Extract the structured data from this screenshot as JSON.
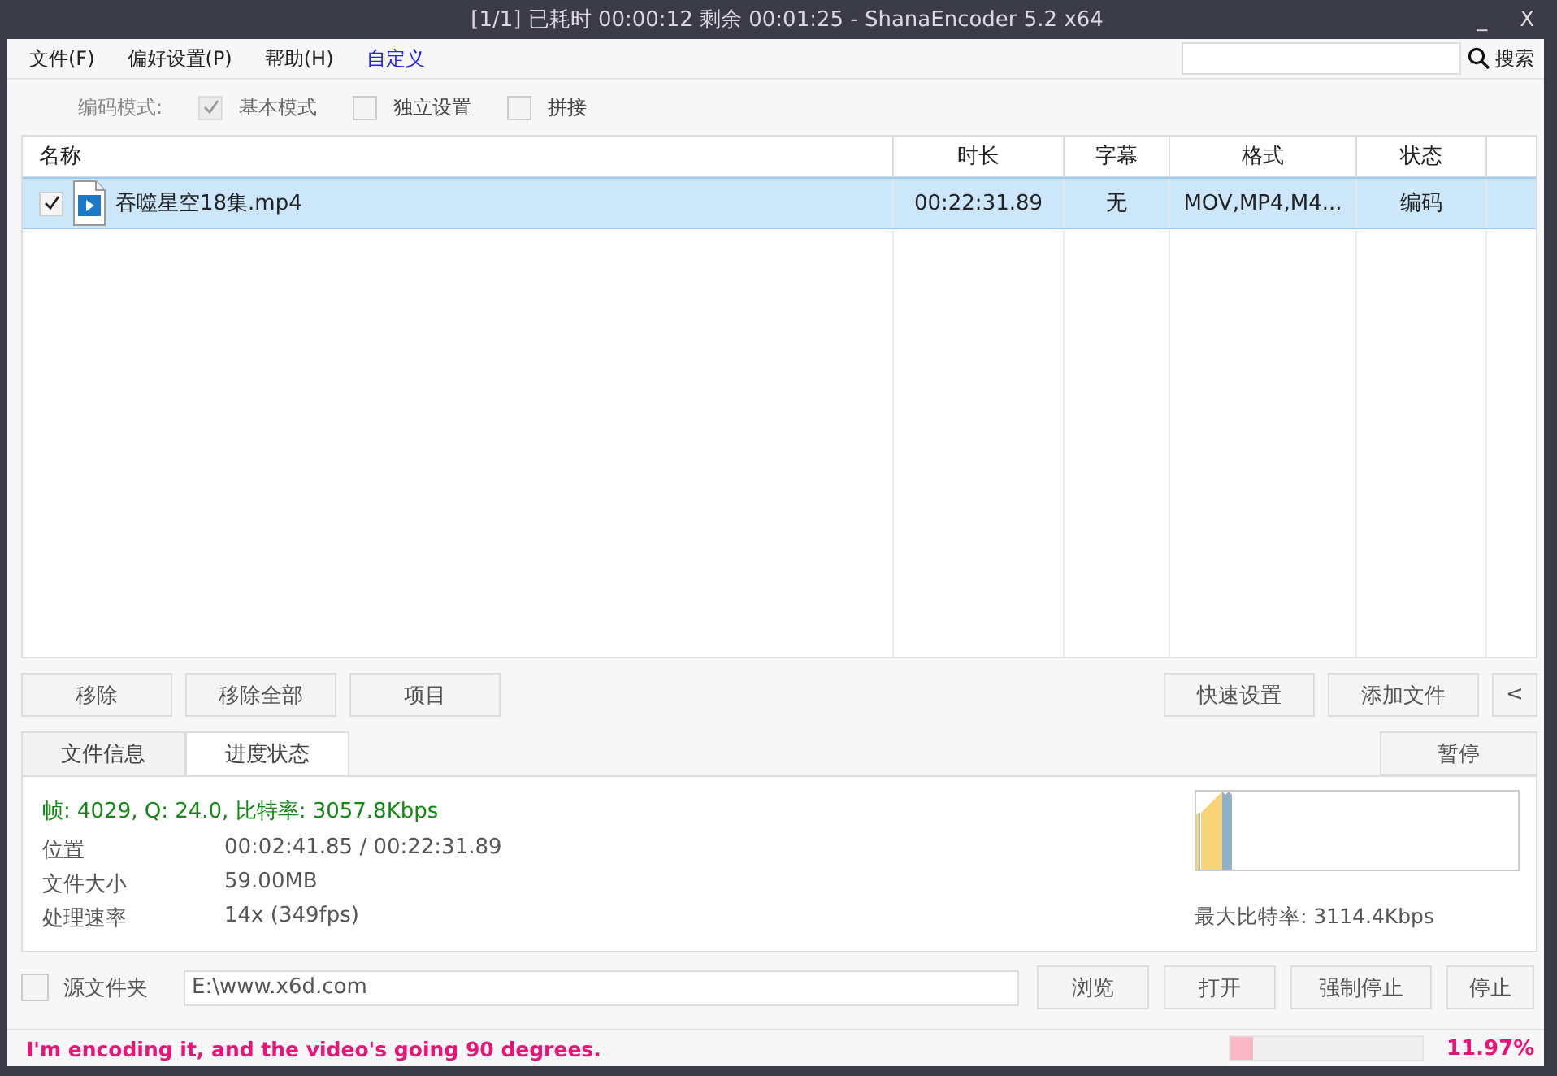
{
  "window": {
    "title": "[1/1] 已耗时 00:00:12  剩余 00:01:25 - ShanaEncoder 5.2 x64",
    "controls": [
      "_",
      "X"
    ]
  },
  "menu": [
    {
      "label": "文件(F)",
      "kind": "menu"
    },
    {
      "label": "偏好设置(P)",
      "kind": "menu"
    },
    {
      "label": "帮助(H)",
      "kind": "menu"
    },
    {
      "label": "自定义",
      "kind": "link"
    }
  ],
  "search": {
    "label": "搜索"
  },
  "encode_mode": {
    "label": "编码模式:",
    "options": [
      {
        "label": "基本模式",
        "checked": true,
        "disabled": true
      },
      {
        "label": "独立设置",
        "checked": false,
        "disabled": false
      },
      {
        "label": "拼接",
        "checked": false,
        "disabled": false
      }
    ]
  },
  "table": {
    "columns": [
      "名称",
      "时长",
      "字幕",
      "格式",
      "状态"
    ],
    "rows": [
      {
        "checked": true,
        "selected": true,
        "name": "吞噬星空18集.mp4",
        "duration": "00:22:31.89",
        "subtitle": "无",
        "format": "MOV,MP4,M4...",
        "status": "编码"
      }
    ]
  },
  "list_buttons": [
    "移除",
    "移除全部",
    "项目"
  ],
  "right_buttons": [
    "快速设置",
    "添加文件",
    "<"
  ],
  "tabs": [
    {
      "label": "文件信息",
      "selected": false
    },
    {
      "label": "进度状态",
      "selected": true
    }
  ],
  "pause_button": "暂停",
  "progress": {
    "summary": "帧: 4029, Q: 24.0, 比特率: 3057.8Kbps",
    "fields": [
      {
        "label": "位置",
        "value": "00:02:41.85 / 00:22:31.89"
      },
      {
        "label": "文件大小",
        "value": "59.00MB"
      },
      {
        "label": "处理速率",
        "value": "14x (349fps)"
      }
    ],
    "max_bitrate": "最大比特率: 3114.4Kbps"
  },
  "output": {
    "checked": false,
    "label": "源文件夹",
    "value": "E:\\www.x6d.com",
    "buttons": [
      "浏览",
      "打开",
      "强制停止",
      "停止"
    ]
  },
  "status_bar": {
    "message": "I'm encoding it, and the video's going 90 degrees.",
    "level": 0.1197,
    "percent": "11.97%"
  }
}
